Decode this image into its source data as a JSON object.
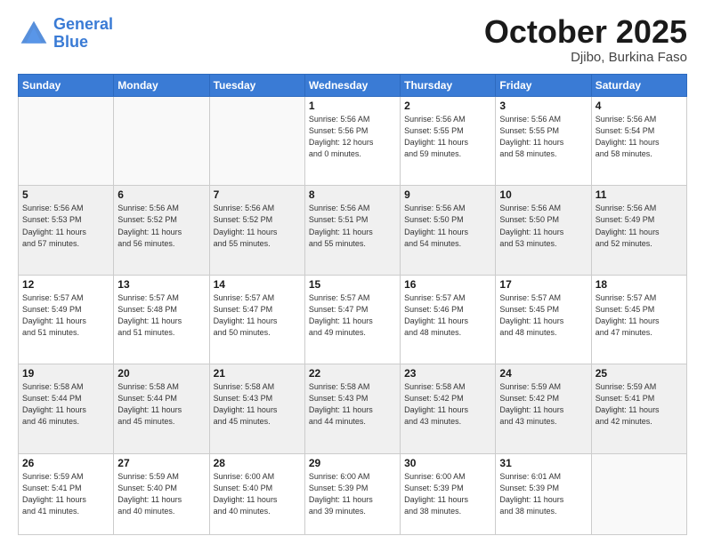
{
  "header": {
    "logo_line1": "General",
    "logo_line2": "Blue",
    "month": "October 2025",
    "location": "Djibo, Burkina Faso"
  },
  "weekdays": [
    "Sunday",
    "Monday",
    "Tuesday",
    "Wednesday",
    "Thursday",
    "Friday",
    "Saturday"
  ],
  "weeks": [
    [
      {
        "day": "",
        "info": ""
      },
      {
        "day": "",
        "info": ""
      },
      {
        "day": "",
        "info": ""
      },
      {
        "day": "1",
        "info": "Sunrise: 5:56 AM\nSunset: 5:56 PM\nDaylight: 12 hours\nand 0 minutes."
      },
      {
        "day": "2",
        "info": "Sunrise: 5:56 AM\nSunset: 5:55 PM\nDaylight: 11 hours\nand 59 minutes."
      },
      {
        "day": "3",
        "info": "Sunrise: 5:56 AM\nSunset: 5:55 PM\nDaylight: 11 hours\nand 58 minutes."
      },
      {
        "day": "4",
        "info": "Sunrise: 5:56 AM\nSunset: 5:54 PM\nDaylight: 11 hours\nand 58 minutes."
      }
    ],
    [
      {
        "day": "5",
        "info": "Sunrise: 5:56 AM\nSunset: 5:53 PM\nDaylight: 11 hours\nand 57 minutes."
      },
      {
        "day": "6",
        "info": "Sunrise: 5:56 AM\nSunset: 5:52 PM\nDaylight: 11 hours\nand 56 minutes."
      },
      {
        "day": "7",
        "info": "Sunrise: 5:56 AM\nSunset: 5:52 PM\nDaylight: 11 hours\nand 55 minutes."
      },
      {
        "day": "8",
        "info": "Sunrise: 5:56 AM\nSunset: 5:51 PM\nDaylight: 11 hours\nand 55 minutes."
      },
      {
        "day": "9",
        "info": "Sunrise: 5:56 AM\nSunset: 5:50 PM\nDaylight: 11 hours\nand 54 minutes."
      },
      {
        "day": "10",
        "info": "Sunrise: 5:56 AM\nSunset: 5:50 PM\nDaylight: 11 hours\nand 53 minutes."
      },
      {
        "day": "11",
        "info": "Sunrise: 5:56 AM\nSunset: 5:49 PM\nDaylight: 11 hours\nand 52 minutes."
      }
    ],
    [
      {
        "day": "12",
        "info": "Sunrise: 5:57 AM\nSunset: 5:49 PM\nDaylight: 11 hours\nand 51 minutes."
      },
      {
        "day": "13",
        "info": "Sunrise: 5:57 AM\nSunset: 5:48 PM\nDaylight: 11 hours\nand 51 minutes."
      },
      {
        "day": "14",
        "info": "Sunrise: 5:57 AM\nSunset: 5:47 PM\nDaylight: 11 hours\nand 50 minutes."
      },
      {
        "day": "15",
        "info": "Sunrise: 5:57 AM\nSunset: 5:47 PM\nDaylight: 11 hours\nand 49 minutes."
      },
      {
        "day": "16",
        "info": "Sunrise: 5:57 AM\nSunset: 5:46 PM\nDaylight: 11 hours\nand 48 minutes."
      },
      {
        "day": "17",
        "info": "Sunrise: 5:57 AM\nSunset: 5:45 PM\nDaylight: 11 hours\nand 48 minutes."
      },
      {
        "day": "18",
        "info": "Sunrise: 5:57 AM\nSunset: 5:45 PM\nDaylight: 11 hours\nand 47 minutes."
      }
    ],
    [
      {
        "day": "19",
        "info": "Sunrise: 5:58 AM\nSunset: 5:44 PM\nDaylight: 11 hours\nand 46 minutes."
      },
      {
        "day": "20",
        "info": "Sunrise: 5:58 AM\nSunset: 5:44 PM\nDaylight: 11 hours\nand 45 minutes."
      },
      {
        "day": "21",
        "info": "Sunrise: 5:58 AM\nSunset: 5:43 PM\nDaylight: 11 hours\nand 45 minutes."
      },
      {
        "day": "22",
        "info": "Sunrise: 5:58 AM\nSunset: 5:43 PM\nDaylight: 11 hours\nand 44 minutes."
      },
      {
        "day": "23",
        "info": "Sunrise: 5:58 AM\nSunset: 5:42 PM\nDaylight: 11 hours\nand 43 minutes."
      },
      {
        "day": "24",
        "info": "Sunrise: 5:59 AM\nSunset: 5:42 PM\nDaylight: 11 hours\nand 43 minutes."
      },
      {
        "day": "25",
        "info": "Sunrise: 5:59 AM\nSunset: 5:41 PM\nDaylight: 11 hours\nand 42 minutes."
      }
    ],
    [
      {
        "day": "26",
        "info": "Sunrise: 5:59 AM\nSunset: 5:41 PM\nDaylight: 11 hours\nand 41 minutes."
      },
      {
        "day": "27",
        "info": "Sunrise: 5:59 AM\nSunset: 5:40 PM\nDaylight: 11 hours\nand 40 minutes."
      },
      {
        "day": "28",
        "info": "Sunrise: 6:00 AM\nSunset: 5:40 PM\nDaylight: 11 hours\nand 40 minutes."
      },
      {
        "day": "29",
        "info": "Sunrise: 6:00 AM\nSunset: 5:39 PM\nDaylight: 11 hours\nand 39 minutes."
      },
      {
        "day": "30",
        "info": "Sunrise: 6:00 AM\nSunset: 5:39 PM\nDaylight: 11 hours\nand 38 minutes."
      },
      {
        "day": "31",
        "info": "Sunrise: 6:01 AM\nSunset: 5:39 PM\nDaylight: 11 hours\nand 38 minutes."
      },
      {
        "day": "",
        "info": ""
      }
    ]
  ]
}
